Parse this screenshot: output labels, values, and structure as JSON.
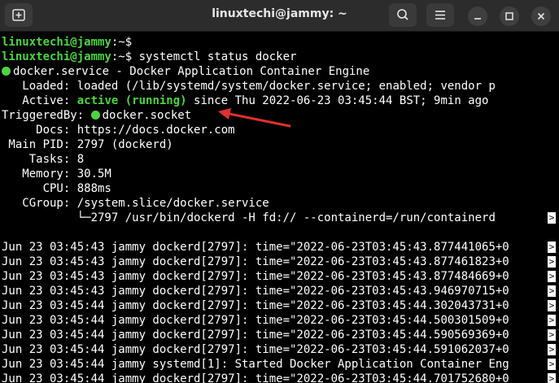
{
  "window": {
    "title": "linuxtechi@jammy: ~"
  },
  "prompt": {
    "user_host": "linuxtechi@jammy",
    "sep_path": ":~",
    "symbol": "$"
  },
  "lines": {
    "cmd1": "",
    "cmd2": " systemctl status docker",
    "service": "docker.service - Docker Application Container Engine",
    "loaded_label": "   Loaded:",
    "loaded_value": " loaded (/lib/systemd/system/docker.service; enabled; vendor p",
    "active_label": "   Active:",
    "active_state": " active (running)",
    "active_rest": " since Thu 2022-06-23 03:45:44 BST; 9min ago",
    "triggered_label": "TriggeredBy:",
    "triggered_value": "docker.socket",
    "docs": "     Docs: https://docs.docker.com",
    "mainpid": " Main PID: 2797 (dockerd)",
    "tasks": "    Tasks: 8",
    "memory": "   Memory: 30.5M",
    "cpu": "      CPU: 888ms",
    "cgroup": "   CGroup: /system.slice/docker.service",
    "cgroup_child": "           └─2797 /usr/bin/dockerd -H fd:// --containerd=/run/containerd"
  },
  "log_lines": [
    "Jun 23 03:45:43 jammy dockerd[2797]: time=\"2022-06-23T03:45:43.877441065+0",
    "Jun 23 03:45:43 jammy dockerd[2797]: time=\"2022-06-23T03:45:43.877461823+0",
    "Jun 23 03:45:43 jammy dockerd[2797]: time=\"2022-06-23T03:45:43.877484669+0",
    "Jun 23 03:45:43 jammy dockerd[2797]: time=\"2022-06-23T03:45:43.946970715+0",
    "Jun 23 03:45:44 jammy dockerd[2797]: time=\"2022-06-23T03:45:44.302043731+0",
    "Jun 23 03:45:44 jammy dockerd[2797]: time=\"2022-06-23T03:45:44.500301509+0",
    "Jun 23 03:45:44 jammy dockerd[2797]: time=\"2022-06-23T03:45:44.590569369+0",
    "Jun 23 03:45:44 jammy dockerd[2797]: time=\"2022-06-23T03:45:44.591062037+0",
    "Jun 23 03:45:44 jammy systemd[1]: Started Docker Application Container Eng",
    "Jun 23 03:45:44 jammy dockerd[2797]: time=\"2022-06-23T03:45:44.701752680+0"
  ],
  "overflow_marker": ">",
  "colors": {
    "prompt_green": "#4ed443",
    "path_blue": "#6f9bd8",
    "annotation_arrow": "#e03030",
    "titlebar": "#2c2c2c"
  },
  "icons": {
    "new_tab": "new-tab-icon",
    "search": "search-icon",
    "menu": "hamburger-menu-icon",
    "minimize": "minimize-icon",
    "maximize": "maximize-icon",
    "close": "close-icon"
  }
}
